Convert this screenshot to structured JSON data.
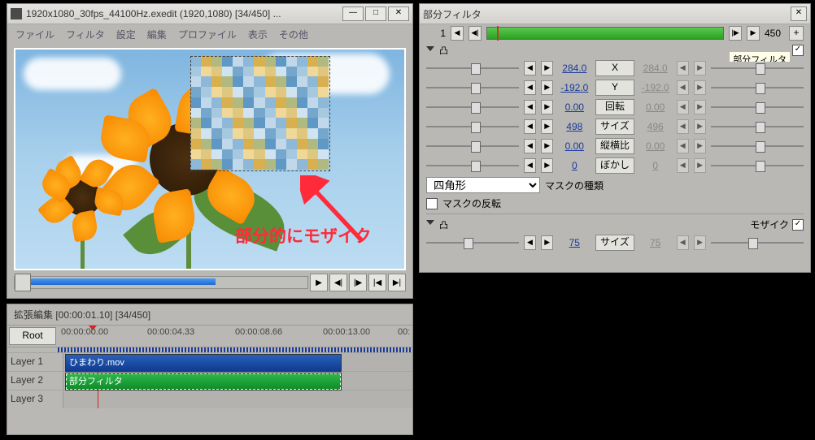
{
  "preview_window": {
    "title": "1920x1080_30fps_44100Hz.exedit (1920,1080) [34/450] ...",
    "menu": [
      "ファイル",
      "フィルタ",
      "設定",
      "編集",
      "プロファイル",
      "表示",
      "その他"
    ],
    "annotation": "部分的にモザイク"
  },
  "timeline_window": {
    "title": "拡張編集 [00:00:01.10] [34/450]",
    "root_label": "Root",
    "time_marks": [
      "00:00:00.00",
      "00:00:04.33",
      "00:00:08.66",
      "00:00:13.00"
    ],
    "scroll_mark": "00:",
    "layers": [
      {
        "name": "Layer 1",
        "clip": "ひまわり.mov",
        "cls": "blue"
      },
      {
        "name": "Layer 2",
        "clip": "部分フィルタ",
        "cls": "green"
      },
      {
        "name": "Layer 3"
      }
    ]
  },
  "filter_window": {
    "title": "部分フィルタ",
    "frame_start": "1",
    "frame_end": "450",
    "tag_label": "部分フィルタ",
    "params": [
      {
        "label": "X",
        "v1": "284.0",
        "v2": "284.0"
      },
      {
        "label": "Y",
        "v1": "-192.0",
        "v2": "-192.0"
      },
      {
        "label": "回転",
        "v1": "0.00",
        "v2": "0.00"
      },
      {
        "label": "サイズ",
        "v1": "498",
        "v2": "496"
      },
      {
        "label": "縦横比",
        "v1": "0.00",
        "v2": "0.00"
      },
      {
        "label": "ぼかし",
        "v1": "0",
        "v2": "0"
      }
    ],
    "mask_shape": "四角形",
    "mask_type_label": "マスクの種類",
    "mask_invert_label": "マスクの反転",
    "mosaic_label": "モザイク",
    "mosaic_param": {
      "label": "サイズ",
      "v1": "75",
      "v2": "75"
    }
  }
}
